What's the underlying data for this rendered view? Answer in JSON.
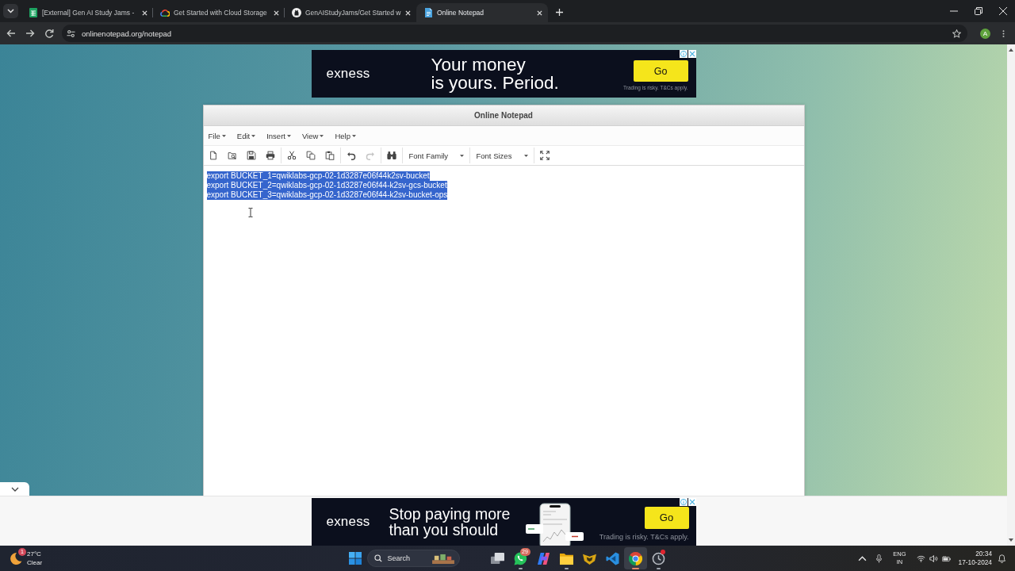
{
  "browser": {
    "tabs": [
      {
        "title": "[External] Gen AI Study Jams -",
        "selected": false
      },
      {
        "title": "Get Started with Cloud Storage",
        "selected": false
      },
      {
        "title": "GenAIStudyJams/Get Started w",
        "selected": false
      },
      {
        "title": "Online Notepad",
        "selected": true
      }
    ],
    "address": "onlinenotepad.org/notepad",
    "profile_initial": "A"
  },
  "top_ad": {
    "brand": "exness",
    "headline": [
      "Your money",
      "is yours. Period."
    ],
    "button": "Go",
    "disclaimer": "Trading is risky. T&Cs apply."
  },
  "notepad": {
    "title": "Online Notepad",
    "menus": [
      "File",
      "Edit",
      "Insert",
      "View",
      "Help"
    ],
    "toolbar": {
      "undo": {
        "disabled": false
      },
      "redo": {
        "disabled": true
      },
      "dropdowns": [
        "Font Family",
        "Font Sizes"
      ]
    },
    "lines": [
      {
        "text": "export BUCKET_1=qwiklabs-gcp-02-1d3287e06f44k2sv-bucket",
        "selected": true
      },
      {
        "text": "export BUCKET_2=qwiklabs-gcp-02-1d3287e06f44-k2sv-gcs-bucket",
        "selected": true
      },
      {
        "text": "export BUCKET_3=qwiklabs-gcp-02-1d3287e06f44-k2sv-bucket-ops",
        "selected": true
      }
    ]
  },
  "bottom_ad": {
    "brand": "exness",
    "headline": [
      "Stop paying more",
      "than you should"
    ],
    "button": "Go",
    "disclaimer": "Trading is risky. T&Cs apply."
  },
  "taskbar": {
    "weather": {
      "badge": "1",
      "temperature": "27°C",
      "condition": "Clear"
    },
    "search": {
      "placeholder": "Search"
    },
    "apps": [
      {
        "running": false,
        "selected": false,
        "alert": false
      },
      {
        "running": true,
        "selected": false,
        "alert": false,
        "badge": "29"
      },
      {
        "running": false,
        "selected": false,
        "alert": false
      },
      {
        "running": true,
        "selected": false,
        "alert": false
      },
      {
        "running": false,
        "selected": false,
        "alert": false
      },
      {
        "running": false,
        "selected": false,
        "alert": false
      },
      {
        "running": true,
        "selected": true,
        "alert": false
      },
      {
        "running": true,
        "selected": false,
        "alert": true
      }
    ],
    "language": "ENG",
    "region": "IN",
    "time": "20:34",
    "date": "17-10-2024"
  }
}
